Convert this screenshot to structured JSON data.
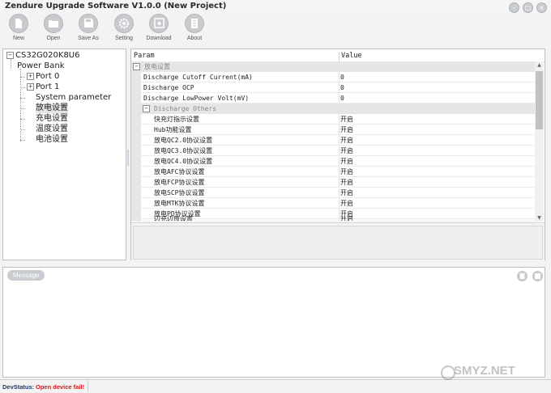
{
  "window": {
    "title": "Zendure Upgrade Software V1.0.0 (New Project)"
  },
  "toolbar": {
    "items": [
      {
        "label": "New",
        "icon": "document-icon"
      },
      {
        "label": "Open",
        "icon": "folder-icon"
      },
      {
        "label": "Save As",
        "icon": "save-icon"
      },
      {
        "label": "Setting",
        "icon": "gear-icon"
      },
      {
        "label": "Download",
        "icon": "download-icon"
      },
      {
        "label": "About",
        "icon": "info-icon"
      }
    ]
  },
  "tree": {
    "root": "CS32G020K8U6",
    "device": "Power Bank",
    "children": [
      "Port 0",
      "Port 1",
      "System parameter",
      "放电设置",
      "充电设置",
      "温度设置",
      "电池设置"
    ],
    "selected": "放电设置"
  },
  "grid": {
    "columns": [
      "Param",
      "Value"
    ],
    "category": "放电设置",
    "rows": [
      {
        "param": "Discharge Cutoff Current(mA)",
        "value": "0"
      },
      {
        "param": "Discharge OCP",
        "value": "0"
      },
      {
        "param": "Discharge LowPower Volt(mV)",
        "value": "0"
      }
    ],
    "subcategory": "Discharge Others",
    "subrows": [
      {
        "param": "快充灯指示设置",
        "value": "开启"
      },
      {
        "param": "Hub功能设置",
        "value": "开启"
      },
      {
        "param": "放电QC2.0协议设置",
        "value": "开启"
      },
      {
        "param": "放电QC3.0协议设置",
        "value": "开启"
      },
      {
        "param": "放电QC4.0协议设置",
        "value": "开启"
      },
      {
        "param": "放电AFC协议设置",
        "value": "开启"
      },
      {
        "param": "放电FCP协议设置",
        "value": "开启"
      },
      {
        "param": "放电SCP协议设置",
        "value": "开启"
      },
      {
        "param": "放电MTK协议设置",
        "value": "开启"
      },
      {
        "param": "放电PD协议设置",
        "value": "开启"
      },
      {
        "param": "边充边放设置",
        "value": "开启"
      }
    ]
  },
  "message": {
    "tab_label": "Message"
  },
  "status": {
    "label": "DevStatus:",
    "value": "Open device fail!"
  },
  "watermark": {
    "text": "SMYZ.NET"
  },
  "colors": {
    "error": "#e0121b",
    "icon_gray": "#c8cacd",
    "category_bg": "#e6e6e6"
  }
}
